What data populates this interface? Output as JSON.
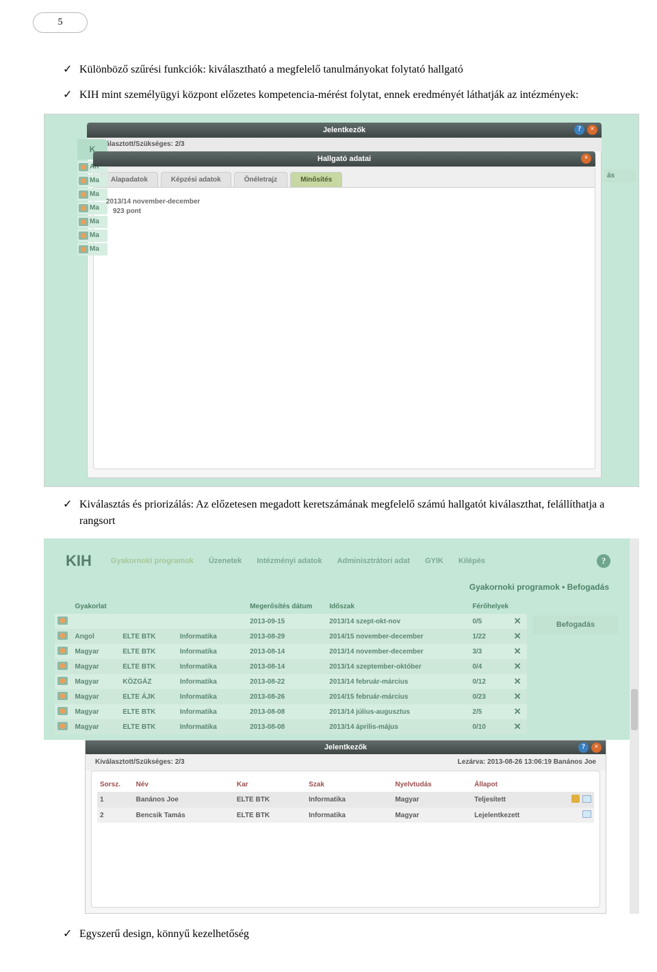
{
  "page_number": "5",
  "bullets": {
    "b1": "Különböző szűrési funkciók: kiválasztható a megfelelő tanulmányokat folytató hallgató",
    "b2": "KIH mint személyügyi központ előzetes kompetencia-mérést folytat, ennek eredményét láthatják az intézmények:",
    "b3": "Kiválasztás és priorizálás: Az előzetesen megadott keretszámának megfelelő számú hallgatót kiválaszthat, felállíthatja a rangsort",
    "b4": "Egyszerű design, könnyű kezelhetőség"
  },
  "modal1": {
    "outer_title": "Jelentkezők",
    "inner_title": "Hallgató adatai",
    "strip_text": "Kiválasztott/Szükséges: 2/3",
    "left_head": "K",
    "left_items": [
      "An",
      "Ma",
      "Ma",
      "Ma",
      "Ma",
      "Ma",
      "Ma"
    ],
    "right_peek": "ás",
    "tabs": [
      "Alapadatok",
      "Képzési adatok",
      "Önéletrajz",
      "Minősítés"
    ],
    "result_line1": "2013/14 november-december",
    "result_line2": "923 pont"
  },
  "app": {
    "brand": "KIH",
    "nav": [
      "Gyakornoki programok",
      "Üzenetek",
      "Intézményi adatok",
      "Adminisztrátori adat",
      "GYIK",
      "Kilépés"
    ],
    "crumb": "Gyakornoki programok • Befogadás",
    "headers": [
      "",
      "Gyakorlat",
      "",
      "",
      "Megerősítés dátum",
      "Időszak",
      "Férőhelyek",
      ""
    ],
    "rows": [
      {
        "c1": "",
        "c2": "",
        "c3": "",
        "c4": "2013-09-15",
        "c5": "2013/14 szept-okt-nov",
        "c6": "0/5"
      },
      {
        "c1": "Angol",
        "c2": "ELTE BTK",
        "c3": "Informatika",
        "c4": "2013-08-29",
        "c5": "2014/15 november-december",
        "c6": "1/22"
      },
      {
        "c1": "Magyar",
        "c2": "ELTE BTK",
        "c3": "Informatika",
        "c4": "2013-08-14",
        "c5": "2013/14 november-december",
        "c6": "3/3"
      },
      {
        "c1": "Magyar",
        "c2": "ELTE BTK",
        "c3": "Informatika",
        "c4": "2013-08-14",
        "c5": "2013/14 szeptember-október",
        "c6": "0/4"
      },
      {
        "c1": "Magyar",
        "c2": "KÖZGÁZ",
        "c3": "Informatika",
        "c4": "2013-08-22",
        "c5": "2013/14 február-március",
        "c6": "0/12"
      },
      {
        "c1": "Magyar",
        "c2": "ELTE ÁJK",
        "c3": "Informatika",
        "c4": "2013-08-26",
        "c5": "2014/15 február-március",
        "c6": "0/23"
      },
      {
        "c1": "Magyar",
        "c2": "ELTE BTK",
        "c3": "Informatika",
        "c4": "2013-08-08",
        "c5": "2013/14 július-augusztus",
        "c6": "2/5"
      },
      {
        "c1": "Magyar",
        "c2": "ELTE BTK",
        "c3": "Informatika",
        "c4": "2013-08-08",
        "c5": "2013/14 április-május",
        "c6": "0/10"
      }
    ],
    "button": "Befogadás"
  },
  "modal2": {
    "title": "Jelentkezők",
    "left_strip": "Kiválasztott/Szükséges: 2/3",
    "right_strip": "Lezárva: 2013-08-26 13:06:19 Banános Joe",
    "headers": [
      "Sorsz.",
      "Név",
      "Kar",
      "Szak",
      "Nyelvtudás",
      "Állapot"
    ],
    "rows": [
      {
        "n": "1",
        "name": "Banános Joe",
        "kar": "ELTE BTK",
        "szak": "Informatika",
        "ny": "Magyar",
        "all": "Teljesített",
        "medal": true
      },
      {
        "n": "2",
        "name": "Bencsik Tamás",
        "kar": "ELTE BTK",
        "szak": "Informatika",
        "ny": "Magyar",
        "all": "Lejelentkezett",
        "medal": false
      }
    ]
  }
}
